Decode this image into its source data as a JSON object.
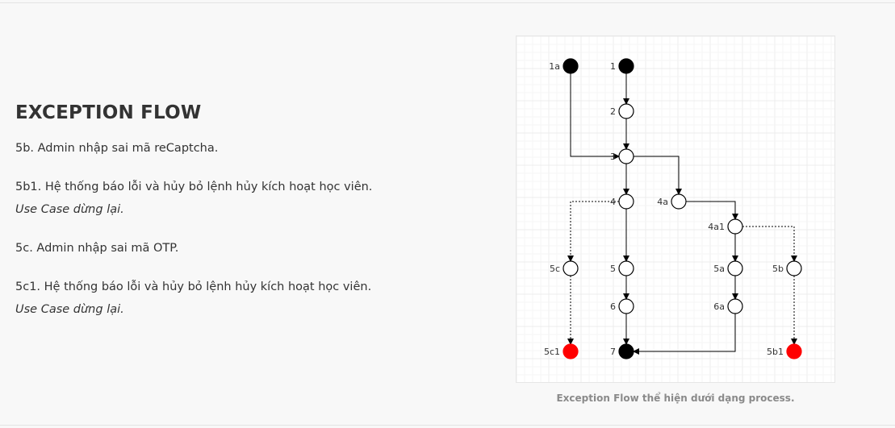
{
  "section": {
    "heading": "EXCEPTION FLOW",
    "paragraphs": [
      {
        "lines": [
          {
            "text": "5b. Admin nhập sai mã reCaptcha.",
            "italic": false
          }
        ]
      },
      {
        "lines": [
          {
            "text": "5b1. Hệ thống báo lỗi và hủy bỏ lệnh hủy kích hoạt học viên.",
            "italic": false
          },
          {
            "text": "Use Case dừng lại.",
            "italic": true
          }
        ]
      },
      {
        "lines": [
          {
            "text": "5c. Admin nhập sai mã OTP.",
            "italic": false
          }
        ]
      },
      {
        "lines": [
          {
            "text": "5c1. Hệ thống báo lỗi và hủy bỏ lệnh hủy kích hoạt học viên.",
            "italic": false
          },
          {
            "text": "Use Case dừng lại.",
            "italic": true
          }
        ]
      }
    ]
  },
  "figure": {
    "caption": "Exception Flow thể hiện dưới dạng process.",
    "colors": {
      "start_node": "#000000",
      "end_node": "#000000",
      "error_end_node": "#ff0000",
      "activity_node": "#ffffff",
      "edge": "#000000"
    },
    "nodes": [
      {
        "id": "1a",
        "label": "1a",
        "kind": "start"
      },
      {
        "id": "1",
        "label": "1",
        "kind": "start"
      },
      {
        "id": "2",
        "label": "2",
        "kind": "activity"
      },
      {
        "id": "3",
        "label": "3",
        "kind": "activity"
      },
      {
        "id": "4",
        "label": "4",
        "kind": "activity"
      },
      {
        "id": "4a",
        "label": "4a",
        "kind": "activity"
      },
      {
        "id": "4a1",
        "label": "4a1",
        "kind": "activity"
      },
      {
        "id": "5c",
        "label": "5c",
        "kind": "activity"
      },
      {
        "id": "5",
        "label": "5",
        "kind": "activity"
      },
      {
        "id": "5a",
        "label": "5a",
        "kind": "activity"
      },
      {
        "id": "5b",
        "label": "5b",
        "kind": "activity"
      },
      {
        "id": "6",
        "label": "6",
        "kind": "activity"
      },
      {
        "id": "6a",
        "label": "6a",
        "kind": "activity"
      },
      {
        "id": "5c1",
        "label": "5c1",
        "kind": "error-end"
      },
      {
        "id": "7",
        "label": "7",
        "kind": "end"
      },
      {
        "id": "5b1",
        "label": "5b1",
        "kind": "error-end"
      }
    ],
    "edges": [
      {
        "from": "1",
        "to": "2",
        "style": "solid"
      },
      {
        "from": "2",
        "to": "3",
        "style": "solid"
      },
      {
        "from": "1a",
        "to": "3",
        "style": "solid"
      },
      {
        "from": "3",
        "to": "4",
        "style": "solid"
      },
      {
        "from": "3",
        "to": "4a",
        "style": "solid"
      },
      {
        "from": "4",
        "to": "5",
        "style": "solid"
      },
      {
        "from": "4",
        "to": "5c",
        "style": "dashed"
      },
      {
        "from": "4a",
        "to": "4a1",
        "style": "solid"
      },
      {
        "from": "4a1",
        "to": "5a",
        "style": "solid"
      },
      {
        "from": "4a1",
        "to": "5b",
        "style": "dashed"
      },
      {
        "from": "5",
        "to": "6",
        "style": "solid"
      },
      {
        "from": "5a",
        "to": "6a",
        "style": "solid"
      },
      {
        "from": "6",
        "to": "7",
        "style": "solid"
      },
      {
        "from": "6a",
        "to": "7",
        "style": "solid"
      },
      {
        "from": "5c",
        "to": "5c1",
        "style": "dashed"
      },
      {
        "from": "5b",
        "to": "5b1",
        "style": "dashed"
      }
    ]
  }
}
